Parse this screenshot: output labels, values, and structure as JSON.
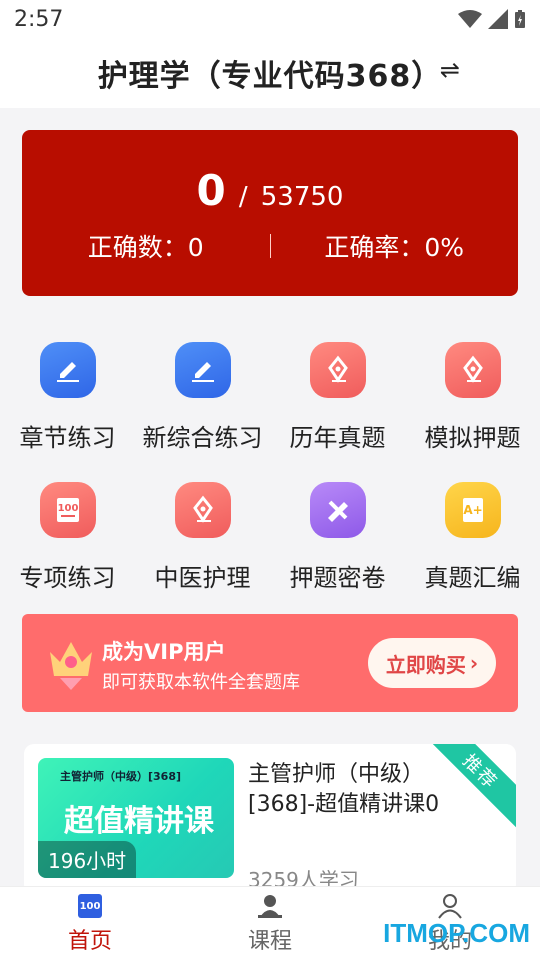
{
  "status": {
    "time": "2:57"
  },
  "header": {
    "title": "护理学（专业代码368）",
    "swap_icon": "swap-icon"
  },
  "stats": {
    "correct_count_big": "0",
    "separator": "/",
    "total": "53750",
    "correct_label": "正确数：0",
    "rate_label": "正确率：0%"
  },
  "grid": {
    "items": [
      {
        "label": "章节练习",
        "icon": "edit-icon",
        "color": "blue"
      },
      {
        "label": "新综合练习",
        "icon": "edit-icon",
        "color": "blue"
      },
      {
        "label": "历年真题",
        "icon": "pen-icon",
        "color": "red"
      },
      {
        "label": "模拟押题",
        "icon": "pen-icon",
        "color": "red"
      },
      {
        "label": "专项练习",
        "icon": "score-100-icon",
        "color": "red"
      },
      {
        "label": "中医护理",
        "icon": "pen-icon",
        "color": "red"
      },
      {
        "label": "押题密卷",
        "icon": "pencil-ruler-icon",
        "color": "purple"
      },
      {
        "label": "真题汇编",
        "icon": "document-star-icon",
        "color": "yellow"
      }
    ]
  },
  "vip": {
    "title": "成为VIP用户",
    "subtitle": "即可获取本软件全套题库",
    "button": "立即购买"
  },
  "course": {
    "thumb_small": "主管护师（中级）[368]",
    "thumb_big": "超值精讲课",
    "hours": "196小时",
    "title": "主管护师（中级）[368]-超值精讲课0",
    "learners": "3259人学习",
    "ribbon": "推荐"
  },
  "tabs": [
    {
      "label": "首页",
      "active": true
    },
    {
      "label": "课程",
      "active": false
    },
    {
      "label": "我的",
      "active": false
    }
  ],
  "watermark": "ITMOP.COM",
  "colors": {
    "accent": "#b80d00",
    "active_tab": "#c0140a",
    "vip_bg": "#ff6c6c"
  }
}
